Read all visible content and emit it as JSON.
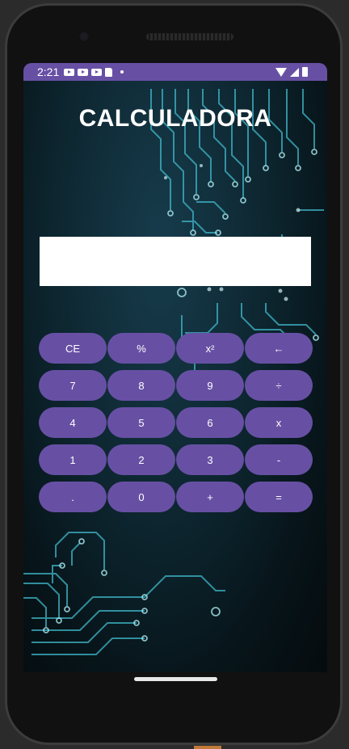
{
  "status_bar": {
    "time": "2:21",
    "left_icons": [
      "youtube-icon",
      "youtube-icon",
      "youtube-icon",
      "sd-card-icon",
      "notification-dot-icon"
    ],
    "right_icons": [
      "wifi-icon",
      "signal-icon",
      "battery-icon"
    ],
    "background_color": "#6750a4"
  },
  "app": {
    "title": "CALCULADORA",
    "display_value": ""
  },
  "keypad": {
    "button_color": "#6750a4",
    "rows": [
      [
        "CE",
        "%",
        "x²",
        "←"
      ],
      [
        "7",
        "8",
        "9",
        "÷"
      ],
      [
        "4",
        "5",
        "6",
        "x"
      ],
      [
        "1",
        "2",
        "3",
        "-"
      ],
      [
        ".",
        "0",
        "+",
        "="
      ]
    ]
  }
}
